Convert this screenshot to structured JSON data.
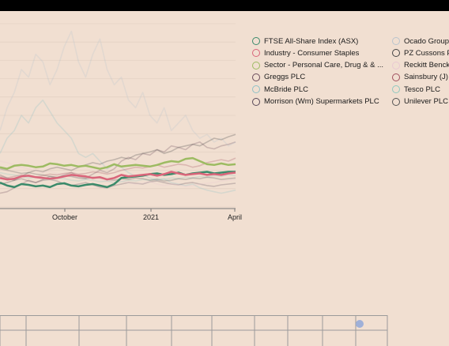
{
  "chart_data": {
    "type": "line",
    "x_tick_labels": [
      "October",
      "2021",
      "April"
    ],
    "grid": true,
    "legend_placement": "top-right",
    "series": [
      {
        "name": "FTSE All-Share Index (ASX)",
        "color": "#3a8a6a",
        "highlight": true,
        "values": [
          0.92,
          0.88,
          0.86,
          0.9,
          0.89,
          0.87,
          0.88,
          0.86,
          0.9,
          0.91,
          0.88,
          0.87,
          0.89,
          0.9,
          0.88,
          0.86,
          0.9,
          0.98,
          0.99,
          1.0,
          1.01,
          1.03,
          1.04,
          1.02,
          1.03,
          1.05,
          1.02,
          1.04,
          1.05,
          1.06,
          1.04,
          1.05,
          1.06,
          1.06
        ]
      },
      {
        "name": "Industry - Consumer Staples",
        "color": "#d9657a",
        "highlight": true,
        "values": [
          0.98,
          0.96,
          0.97,
          1.0,
          1.01,
          0.99,
          0.98,
          0.97,
          0.98,
          1.0,
          1.02,
          1.01,
          1.0,
          0.98,
          0.99,
          0.96,
          0.98,
          1.02,
          1.0,
          1.01,
          1.02,
          1.03,
          1.01,
          1.03,
          1.06,
          1.04,
          1.02,
          1.03,
          1.04,
          1.02,
          1.03,
          1.02,
          1.04,
          1.05
        ]
      },
      {
        "name": "Sector - Personal Care, Drug & Grocery Stores",
        "color": "#9dbb62",
        "highlight": true,
        "values": [
          1.12,
          1.1,
          1.14,
          1.15,
          1.14,
          1.12,
          1.13,
          1.17,
          1.16,
          1.14,
          1.15,
          1.13,
          1.14,
          1.12,
          1.1,
          1.12,
          1.16,
          1.13,
          1.14,
          1.15,
          1.14,
          1.13,
          1.15,
          1.18,
          1.2,
          1.19,
          1.23,
          1.24,
          1.2,
          1.16,
          1.15,
          1.17,
          1.15,
          1.16
        ]
      },
      {
        "name": "Greggs PLC",
        "color": "#6b4a5a",
        "highlight": false,
        "values": [
          0.78,
          0.8,
          0.85,
          0.9,
          0.95,
          0.92,
          0.96,
          1.0,
          0.98,
          1.02,
          1.05,
          1.0,
          0.98,
          1.03,
          1.08,
          1.05,
          1.1,
          1.2,
          1.25,
          1.22,
          1.3,
          1.28,
          1.35,
          1.32,
          1.4,
          1.38,
          1.35,
          1.42,
          1.45,
          1.38,
          1.36,
          1.4,
          1.42,
          1.45
        ]
      },
      {
        "name": "McBride PLC",
        "color": "#8ec1c6",
        "highlight": false,
        "values": [
          1.3,
          1.5,
          1.6,
          1.8,
          1.7,
          1.9,
          2.0,
          1.85,
          1.7,
          1.6,
          1.5,
          1.3,
          1.25,
          1.3,
          1.2,
          1.1,
          1.15,
          1.12,
          1.05,
          1.0,
          1.02,
          0.98,
          0.95,
          0.97,
          0.92,
          0.9,
          0.88,
          0.9,
          0.85,
          0.82,
          0.8,
          0.78,
          0.8,
          0.82
        ]
      },
      {
        "name": "Morrison (Wm) Supermarkets PLC",
        "color": "#5a4a5a",
        "highlight": false,
        "values": [
          1.02,
          0.98,
          0.95,
          0.97,
          0.94,
          0.92,
          0.95,
          0.96,
          0.94,
          0.9,
          0.88,
          0.9,
          0.92,
          0.89,
          0.86,
          0.85,
          0.88,
          0.9,
          0.92,
          0.91,
          0.9,
          0.93,
          0.94,
          0.92,
          0.9,
          0.89,
          0.91,
          0.92,
          0.9,
          0.88,
          0.87,
          0.89,
          0.9,
          0.91
        ]
      },
      {
        "name": "Ocado Group PLC",
        "color": "#b9c4ce",
        "highlight": false,
        "values": [
          1.6,
          1.9,
          2.1,
          2.4,
          2.3,
          2.6,
          2.5,
          2.2,
          2.4,
          2.7,
          2.9,
          2.5,
          2.3,
          2.6,
          2.8,
          2.4,
          2.2,
          2.3,
          2.0,
          1.9,
          2.1,
          1.8,
          1.7,
          1.9,
          1.6,
          1.7,
          1.8,
          1.6,
          1.5,
          1.55,
          1.45,
          1.5,
          1.4,
          1.45
        ]
      },
      {
        "name": "PZ Cussons PLC",
        "color": "#444444",
        "highlight": false,
        "values": [
          0.9,
          0.92,
          0.95,
          1.0,
          1.05,
          1.08,
          1.06,
          1.1,
          1.12,
          1.1,
          1.08,
          1.12,
          1.15,
          1.18,
          1.16,
          1.2,
          1.22,
          1.25,
          1.23,
          1.28,
          1.3,
          1.32,
          1.35,
          1.3,
          1.33,
          1.38,
          1.4,
          1.42,
          1.4,
          1.45,
          1.5,
          1.48,
          1.52,
          1.55
        ]
      },
      {
        "name": "Reckitt Benckiser Group PLC",
        "color": "#e9c8d2",
        "highlight": false,
        "values": [
          1.2,
          1.18,
          1.15,
          1.12,
          1.1,
          1.08,
          1.05,
          1.07,
          1.04,
          1.02,
          1.0,
          0.98,
          0.96,
          0.98,
          0.95,
          0.93,
          0.95,
          0.94,
          0.92,
          0.9,
          0.91,
          0.93,
          0.9,
          0.88,
          0.9,
          0.89,
          0.87,
          0.88,
          0.9,
          0.91,
          0.92,
          0.94,
          0.95,
          0.96
        ]
      },
      {
        "name": "Sainsbury (J) PLC",
        "color": "#a0505e",
        "highlight": false,
        "values": [
          1.0,
          0.98,
          1.0,
          1.02,
          1.0,
          0.99,
          1.01,
          1.03,
          1.02,
          1.04,
          1.05,
          1.03,
          1.04,
          1.06,
          1.05,
          1.03,
          1.05,
          1.08,
          1.1,
          1.12,
          1.11,
          1.13,
          1.15,
          1.12,
          1.14,
          1.16,
          1.15,
          1.12,
          1.14,
          1.18,
          1.2,
          1.22,
          1.2,
          1.24
        ]
      },
      {
        "name": "Tesco PLC",
        "color": "#8fc9bf",
        "highlight": false,
        "values": [
          1.05,
          1.03,
          1.02,
          1.0,
          0.98,
          0.99,
          0.97,
          0.96,
          0.98,
          0.97,
          0.95,
          0.94,
          0.96,
          0.95,
          0.93,
          0.94,
          0.92,
          0.93,
          0.95,
          0.94,
          0.96,
          0.95,
          0.97,
          0.96,
          0.98,
          0.97,
          0.99,
          0.98,
          1.0,
          0.99,
          1.01,
          1.0,
          1.02,
          1.01
        ]
      },
      {
        "name": "Unilever PLC",
        "color": "#555555",
        "highlight": false,
        "values": [
          1.1,
          1.08,
          1.06,
          1.04,
          1.05,
          1.03,
          1.02,
          1.0,
          0.99,
          1.01,
          1.0,
          0.98,
          0.97,
          0.99,
          0.98,
          0.96,
          0.95,
          0.97,
          0.96,
          0.98,
          0.97,
          0.95,
          0.96,
          0.94,
          0.95,
          0.97,
          0.96,
          0.98,
          0.97,
          0.99,
          0.98,
          0.96,
          0.97,
          0.98
        ]
      }
    ]
  }
}
